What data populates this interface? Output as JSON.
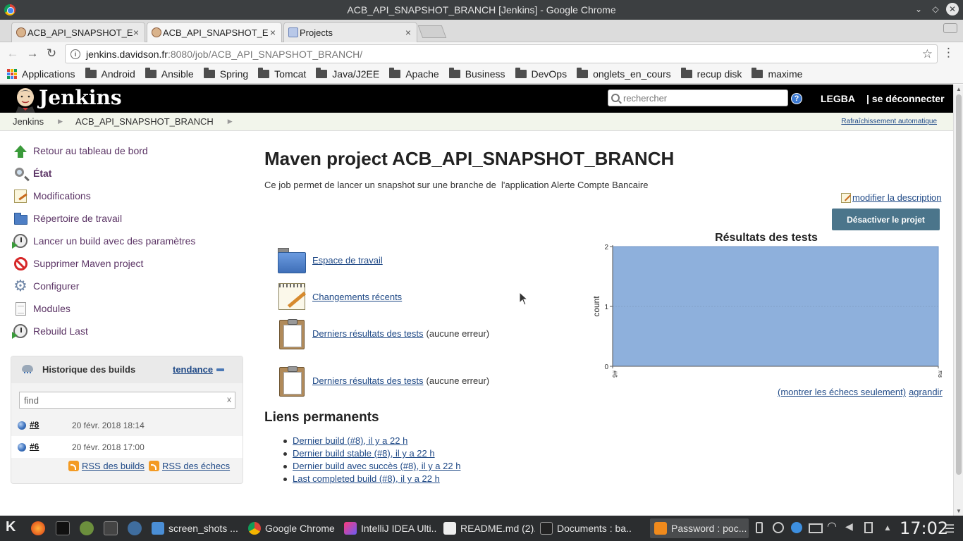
{
  "window": {
    "title": "ACB_API_SNAPSHOT_BRANCH [Jenkins] - Google Chrome",
    "tabs": [
      {
        "label": "ACB_API_SNAPSHOT_E"
      },
      {
        "label": "ACB_API_SNAPSHOT_E"
      },
      {
        "label": "Projects"
      }
    ],
    "close_glyph": "×"
  },
  "address_bar": {
    "host": "jenkins.davidson.fr",
    "path": ":8080/job/ACB_API_SNAPSHOT_BRANCH/"
  },
  "bookmarks": {
    "apps": "Applications",
    "folders": [
      "Android",
      "Ansible",
      "Spring",
      "Tomcat",
      "Java/J2EE",
      "Apache",
      "Business",
      "DevOps",
      "onglets_en_cours",
      "recup disk",
      "maxime"
    ]
  },
  "jenkins": {
    "logo_text": "Jenkins",
    "search_placeholder": "rechercher",
    "help_glyph": "?",
    "user": "LEGBA",
    "logout": "| se déconnecter",
    "breadcrumbs": [
      "Jenkins",
      "ACB_API_SNAPSHOT_BRANCH"
    ],
    "auto_refresh": "Rafraîchissement automatique"
  },
  "sidebar": {
    "tasks": [
      {
        "label": "Retour au tableau de bord",
        "icon": "arrow-up-icon"
      },
      {
        "label": "État",
        "icon": "magnifier-icon"
      },
      {
        "label": "Modifications",
        "icon": "notepad-icon"
      },
      {
        "label": "Répertoire de travail",
        "icon": "folder-icon"
      },
      {
        "label": "Lancer un build avec des paramètres",
        "icon": "clock-icon"
      },
      {
        "label": "Supprimer Maven project",
        "icon": "no-sign-icon"
      },
      {
        "label": "Configurer",
        "icon": "gear-icon"
      },
      {
        "label": "Modules",
        "icon": "document-icon"
      },
      {
        "label": "Rebuild Last",
        "icon": "clock-icon"
      }
    ],
    "build_history": {
      "title": "Historique des builds",
      "trend": "tendance",
      "find_placeholder": "find",
      "find_clear": "x",
      "builds": [
        {
          "number": "#8",
          "date": "20 févr. 2018 18:14"
        },
        {
          "number": "#6",
          "date": "20 févr. 2018 17:00"
        }
      ],
      "rss_all": "RSS des builds",
      "rss_failures": "RSS des échecs"
    }
  },
  "main": {
    "title": "Maven project ACB_API_SNAPSHOT_BRANCH",
    "description": "Ce job permet de lancer un snapshot sur une branche de  l'application Alerte Compte Bancaire",
    "edit_description": "modifier la description",
    "disable_button": "Désactiver le projet",
    "links": [
      {
        "label": "Espace de travail",
        "suffix": ""
      },
      {
        "label": "Changements récents",
        "suffix": ""
      },
      {
        "label": "Derniers résultats des tests",
        "suffix": "(aucune erreur)"
      },
      {
        "label": "Derniers résultats des tests",
        "suffix": "(aucune erreur)"
      }
    ],
    "permalinks_title": "Liens permanents",
    "permalinks": [
      "Dernier build (#8), il y a 22 h",
      "Dernier build stable (#8), il y a 22 h",
      "Dernier build avec succès (#8), il y a 22 h",
      "Last completed build (#8), il y a 22 h"
    ],
    "chart_links": {
      "failures_only": "(montrer les échecs seulement)",
      "enlarge": "agrandir"
    }
  },
  "chart_data": {
    "type": "area",
    "title": "Résultats des tests",
    "ylabel": "count",
    "xlabel": "",
    "x": [
      "#6",
      "#8"
    ],
    "series": [
      {
        "values": [
          2,
          2
        ]
      }
    ],
    "ylim": [
      0,
      2
    ],
    "yticks": [
      0,
      1,
      2
    ],
    "color": "#8eb0dc",
    "grid": true
  },
  "taskbar": {
    "tasks": [
      {
        "label": "screen_shots ..."
      },
      {
        "label": "Google Chrome"
      },
      {
        "label": "IntelliJ IDEA Ulti..."
      },
      {
        "label": "README.md (2)..."
      },
      {
        "label": "Documents : ba..."
      },
      {
        "label": "Password : poc..."
      }
    ],
    "clock": "17:02"
  }
}
